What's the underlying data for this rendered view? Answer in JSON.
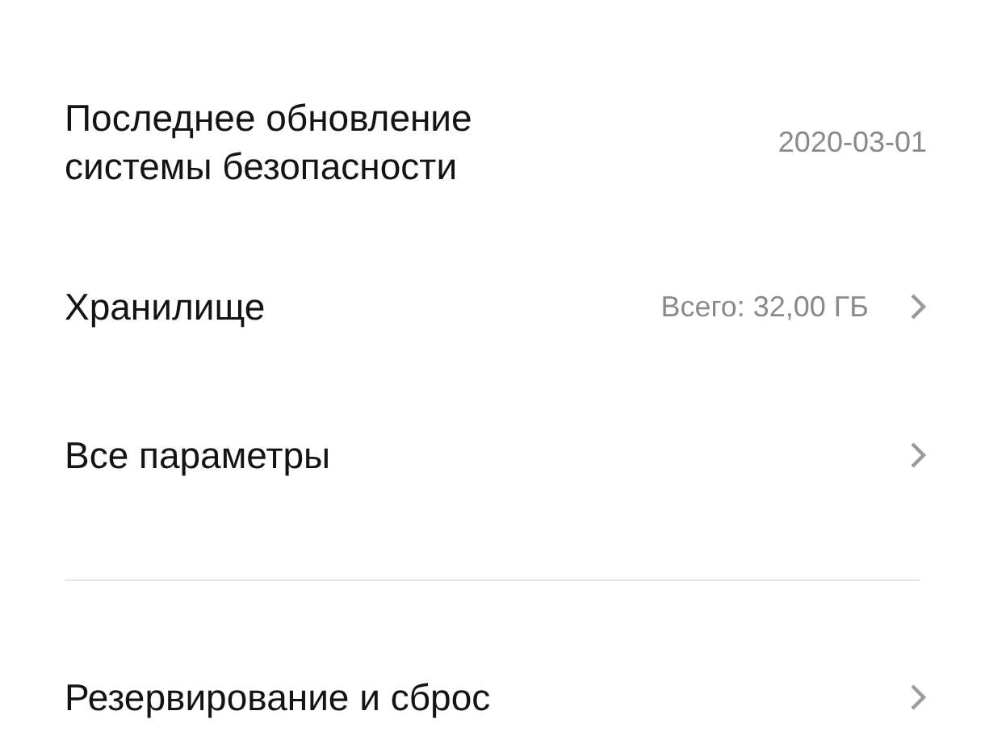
{
  "items": [
    {
      "kind": "row",
      "title": "Последнее обновление системы безопасности",
      "value": "2020-03-01",
      "chevron": false
    },
    {
      "kind": "row",
      "title": "Хранилище",
      "value": "Всего: 32,00 ГБ",
      "chevron": true
    },
    {
      "kind": "row",
      "title": "Все параметры",
      "chevron": true
    },
    {
      "kind": "divider"
    },
    {
      "kind": "row",
      "title": "Резервирование и сброс",
      "chevron": true
    }
  ]
}
